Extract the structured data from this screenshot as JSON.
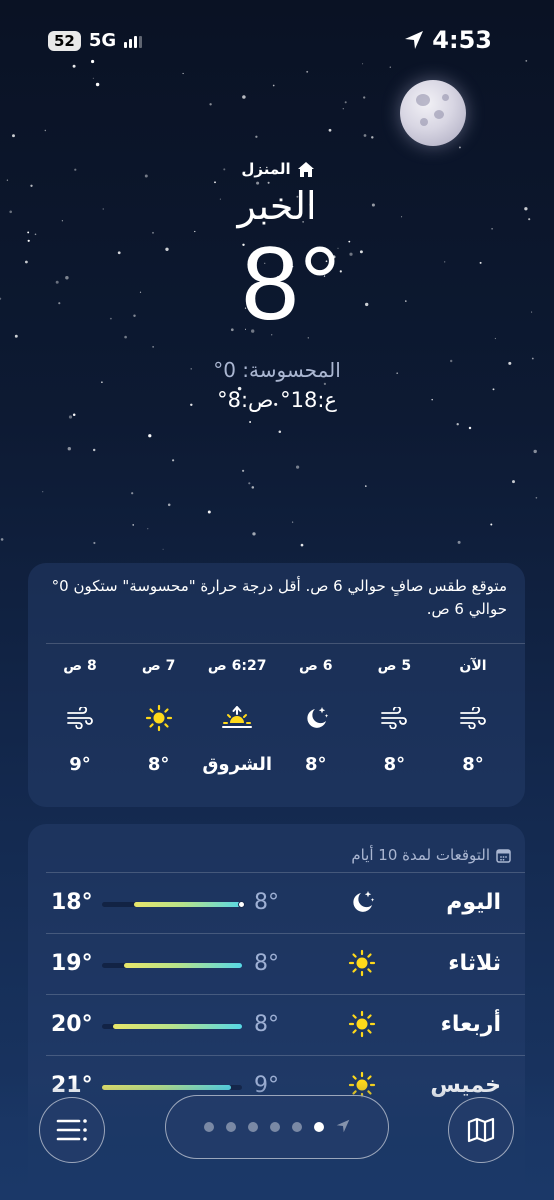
{
  "status_bar": {
    "battery": "52",
    "network": "5G",
    "time": "4:53",
    "icons": [
      "signal-bars-icon",
      "location-arrow-icon"
    ]
  },
  "header": {
    "home_label": "المنزل",
    "home_icon": "house-icon",
    "city": "الخبر",
    "temperature": "8°",
    "feels_like": "المحسوسة: 0°",
    "high_low": "ع:18°  ص:8°"
  },
  "hourly": {
    "summary": "متوقع طقس صافٍ حوالي 6 ص. أقل درجة حرارة \"محسوسة\" ستكون 0° حوالي 6 ص.",
    "items": [
      {
        "label": "الآن",
        "icon": "wind-icon",
        "temp": "8°"
      },
      {
        "label": "5 ص",
        "icon": "wind-icon",
        "temp": "8°"
      },
      {
        "label": "6 ص",
        "icon": "moon-stars-icon",
        "temp": "8°"
      },
      {
        "label": "6:27 ص",
        "icon": "sunrise-icon",
        "temp": "الشروق"
      },
      {
        "label": "7 ص",
        "icon": "sun-icon",
        "temp": "8°"
      },
      {
        "label": "8 ص",
        "icon": "wind-icon",
        "temp": "9°"
      }
    ]
  },
  "forecast": {
    "title": "التوقعات لمدة 10 أيام",
    "title_icon": "calendar-icon",
    "range": [
      8,
      21
    ],
    "days": [
      {
        "name": "اليوم",
        "icon": "moon-stars-icon",
        "low": "8°",
        "high": "18°",
        "low_value": 8,
        "high_value": 18,
        "current_value": 8
      },
      {
        "name": "ثلاثاء",
        "icon": "sun-icon",
        "low": "8°",
        "high": "19°",
        "low_value": 8,
        "high_value": 19
      },
      {
        "name": "أربعاء",
        "icon": "sun-icon",
        "low": "8°",
        "high": "20°",
        "low_value": 8,
        "high_value": 20
      },
      {
        "name": "خميس",
        "icon": "sun-icon",
        "low": "9°",
        "high": "21°",
        "low_value": 9,
        "high_value": 21
      }
    ]
  },
  "toolbar": {
    "list_icon": "list-icon",
    "map_icon": "map-icon",
    "page_count": 6,
    "active_page": 6
  }
}
